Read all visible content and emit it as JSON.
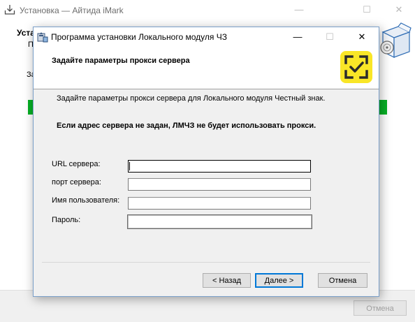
{
  "background_window": {
    "title": "Установка — Айтида iMark",
    "heading": "Уста",
    "subheading": "Пс",
    "status_line": "За",
    "progress_percent": 100,
    "cancel_label": "Отмена",
    "controls": {
      "minimize": "—",
      "maximize": "☐",
      "close": "✕"
    }
  },
  "dialog": {
    "title": "Программа установки Локального модуля ЧЗ",
    "controls": {
      "minimize": "—",
      "maximize": "☐",
      "close": "✕"
    },
    "header_title": "Задайте параметры прокси сервера",
    "description": "Задайте параметры прокси сервера для Локального модуля Честный знак.",
    "warning": "Если адрес сервера не задан, ЛМЧЗ не будет использовать прокси.",
    "fields": [
      {
        "label": "URL сервера:",
        "value": ""
      },
      {
        "label": "порт сервера:",
        "value": ""
      },
      {
        "label": "Имя пользователя:",
        "value": ""
      },
      {
        "label": "Пароль:",
        "value": ""
      }
    ],
    "buttons": {
      "back": "< Назад",
      "next": "Далее >",
      "cancel": "Отмена"
    }
  },
  "colors": {
    "progress": "#06b025",
    "brand_yellow": "#f9e627",
    "brand_dark": "#2b2b2b",
    "accent": "#0078d7"
  },
  "icons": [
    "installer-download-icon",
    "installer-setup-icon",
    "chestny-znak-logo-icon",
    "software-box-icon"
  ]
}
